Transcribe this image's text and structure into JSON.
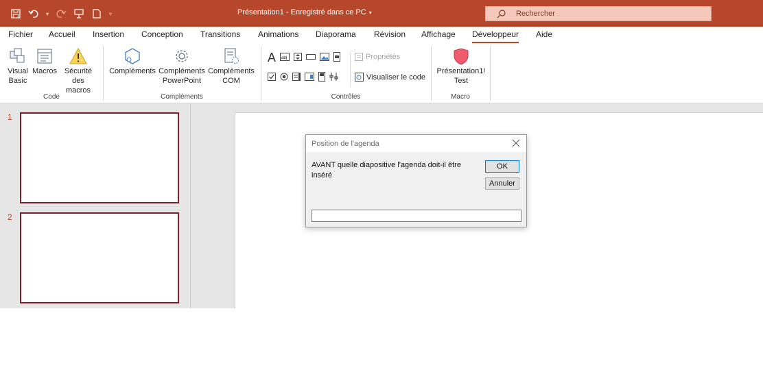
{
  "titlebar": {
    "title": "Présentation1 - Enregistré dans ce PC",
    "search_placeholder": "Rechercher",
    "icons": [
      "save-icon",
      "undo-icon",
      "redo-icon",
      "present-icon",
      "new-file-icon",
      "customize-qat-icon"
    ],
    "accent": "#b7472a"
  },
  "tabs": [
    "Fichier",
    "Accueil",
    "Insertion",
    "Conception",
    "Transitions",
    "Animations",
    "Diaporama",
    "Révision",
    "Affichage",
    "Développeur",
    "Aide"
  ],
  "active_tab": "Développeur",
  "ribbon": {
    "code": {
      "label": "Code",
      "visual_basic": "Visual Basic",
      "visual_basic_l1": "Visual",
      "visual_basic_l2": "Basic",
      "macros": "Macros",
      "securite_l1": "Sécurité",
      "securite_l2": "des macros"
    },
    "complements": {
      "label": "Compléments",
      "complements": "Compléments",
      "ppt_l1": "Compléments",
      "ppt_l2": "PowerPoint",
      "com_l1": "Compléments",
      "com_l2": "COM"
    },
    "controles": {
      "label": "Contrôles",
      "proprietes": "Propriétés",
      "visualiser": "Visualiser le code"
    },
    "macro": {
      "label": "Macro",
      "pres_l1": "Présentation1!",
      "pres_l2": "Test"
    }
  },
  "slides": [
    {
      "number": "1"
    },
    {
      "number": "2"
    }
  ],
  "dialog": {
    "title": "Position de l'agenda",
    "prompt": "AVANT quelle diapositive l'agenda doit-il être inséré",
    "ok": "OK",
    "cancel": "Annuler",
    "input_value": ""
  }
}
